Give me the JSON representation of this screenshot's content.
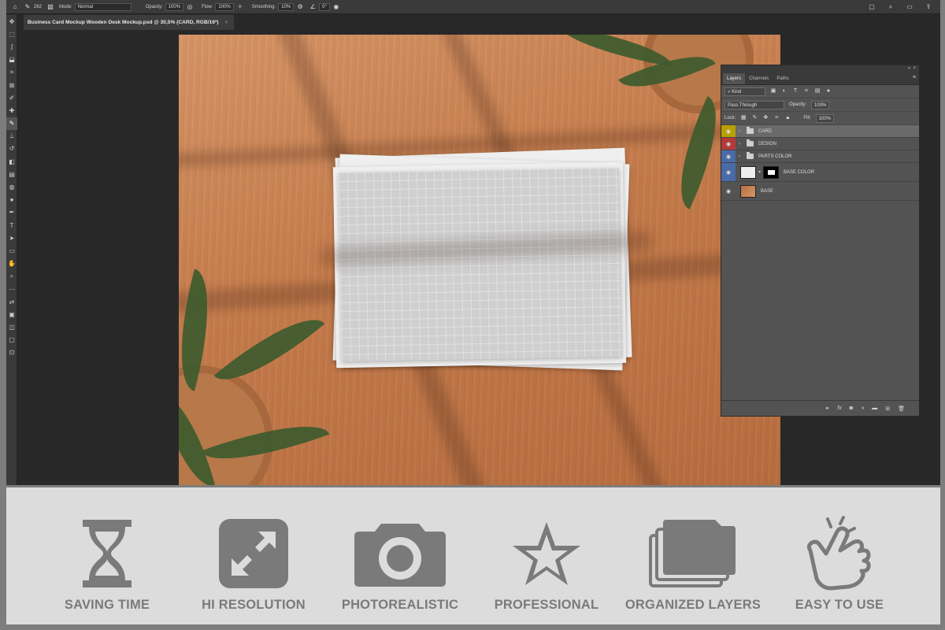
{
  "options_bar": {
    "brush_size": "262",
    "mode_label": "Mode:",
    "mode_value": "Normal",
    "opacity_label": "Opacity:",
    "opacity_value": "100%",
    "flow_label": "Flow:",
    "flow_value": "100%",
    "smoothing_label": "Smoothing:",
    "smoothing_value": "10%",
    "angle_value": "0°"
  },
  "document_tab": {
    "title": "Business Card Mockup Wooden Desk Mockup.psd @ 30,5% (CARD, RGB/16*)",
    "close": "×"
  },
  "toolbar_icons": [
    "move-icon",
    "marquee-icon",
    "lasso-icon",
    "object-select-icon",
    "crop-icon",
    "frame-icon",
    "eyedropper-icon",
    "healing-icon",
    "brush-icon",
    "stamp-icon",
    "history-brush-icon",
    "eraser-icon",
    "gradient-icon",
    "blur-icon",
    "dodge-icon",
    "pen-icon",
    "type-icon",
    "path-select-icon",
    "shape-icon",
    "hand-icon",
    "zoom-icon",
    "more-icon",
    "swap-icon",
    "color-swatches-icon",
    "quickmask-icon",
    "screenmode-icon",
    "artboard-icon"
  ],
  "layers_panel": {
    "tabs": [
      "Layers",
      "Channels",
      "Paths"
    ],
    "active_tab": "Layers",
    "kind_label": "Kind",
    "blend_mode": "Pass Through",
    "opacity_label": "Opacity:",
    "opacity_value": "100%",
    "lock_label": "Lock:",
    "fill_label": "Fill:",
    "fill_value": "100%",
    "layers": [
      {
        "name": "CARD",
        "type": "group",
        "color": "#b8a000",
        "selected": true
      },
      {
        "name": "DESIGN",
        "type": "group",
        "color": "#b33a3a",
        "selected": false
      },
      {
        "name": "PARTS COLOR",
        "type": "group",
        "color": "#4a6aa8",
        "selected": false
      },
      {
        "name": "BASE COLOR",
        "type": "layer-with-mask",
        "color": "#4a6aa8",
        "selected": false
      },
      {
        "name": "BASE",
        "type": "image",
        "color": "",
        "selected": false
      }
    ],
    "footer_icons": [
      "link-icon",
      "fx-icon",
      "mask-icon",
      "adjustment-icon",
      "group-icon",
      "new-layer-icon",
      "trash-icon"
    ]
  },
  "features": [
    {
      "label": "SAVING TIME",
      "icon": "hourglass-icon"
    },
    {
      "label": "HI RESOLUTION",
      "icon": "expand-arrows-icon"
    },
    {
      "label": "PHOTOREALISTIC",
      "icon": "camera-icon"
    },
    {
      "label": "PROFESSIONAL",
      "icon": "star-icon"
    },
    {
      "label": "ORGANIZED LAYERS",
      "icon": "stacked-folders-icon"
    },
    {
      "label": "EASY TO USE",
      "icon": "tap-hand-icon"
    }
  ],
  "colors": {
    "feature_icon": "#7a7a7a",
    "feature_bg": "#dcdcdc",
    "ps_panel": "#535353",
    "wood": "#c57b4b"
  }
}
